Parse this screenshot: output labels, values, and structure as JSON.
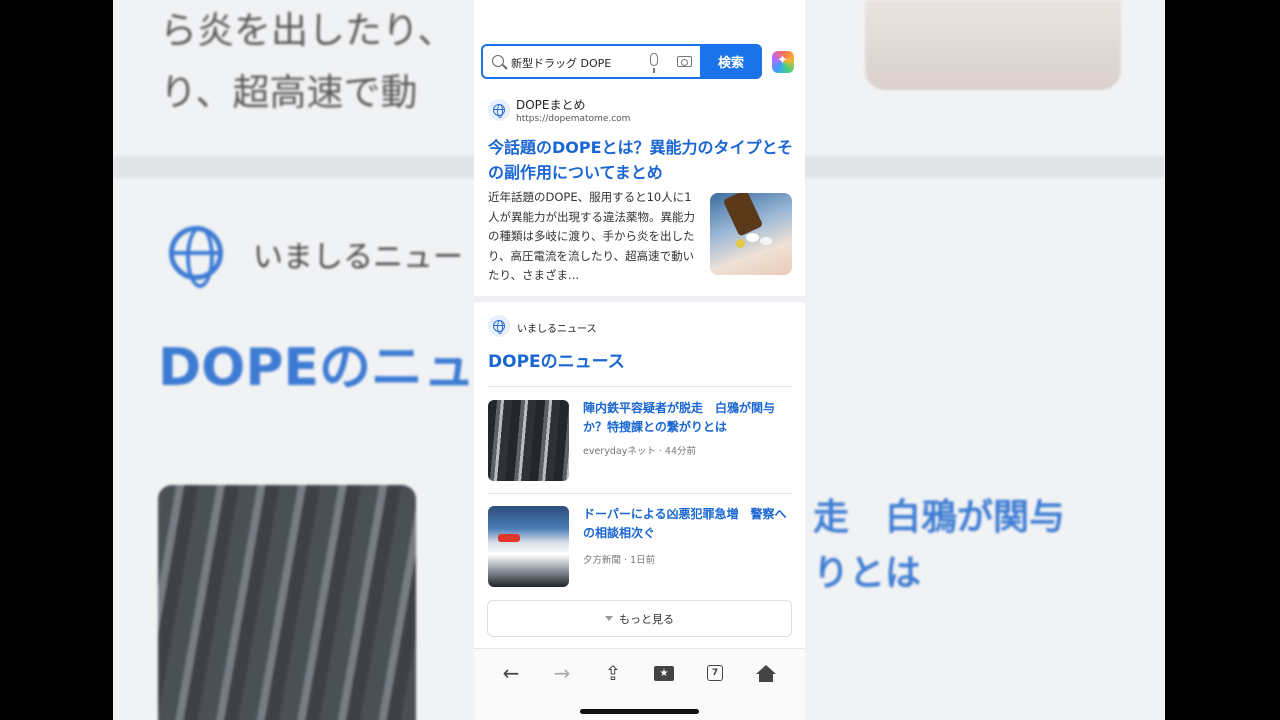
{
  "background": {
    "text_line1": "ら炎を出したり、",
    "text_line2": "り、超高速で動",
    "source": "いましるニュー",
    "title": "DOPEのニュ",
    "right_line1": "走　白鴉が関与",
    "right_line2": "りとは"
  },
  "search": {
    "query": "新型ドラッグ DOPE",
    "button_label": "検索"
  },
  "result": {
    "site_name": "DOPEまとめ",
    "site_url": "https://dopematome.com",
    "title": "今話題のDOPEとは？異能力のタイプとその副作用についてまとめ",
    "snippet": "近年話題のDOPE、服用すると10人に1人が異能力が出現する違法薬物。異能力の種類は多岐に渡り、手から炎を出したり、高圧電流を流したり、超高速で動いたり、さまざま..."
  },
  "news": {
    "source": "いましるニュース",
    "heading": "DOPEのニュース",
    "items": [
      {
        "title": "陣内鉄平容疑者が脱走　白鴉が関与か？特捜課との繋がりとは",
        "publisher": "everydayネット",
        "time": "44分前"
      },
      {
        "title": "ドーパーによる凶悪犯罪急増　警察への相談相次ぐ",
        "publisher": "夕方新聞",
        "time": "1日前"
      }
    ],
    "more_label": "もっと見る"
  },
  "toolbar": {
    "tab_count": "7"
  },
  "colors": {
    "accent": "#1a73e8",
    "link": "#1a66d2"
  }
}
